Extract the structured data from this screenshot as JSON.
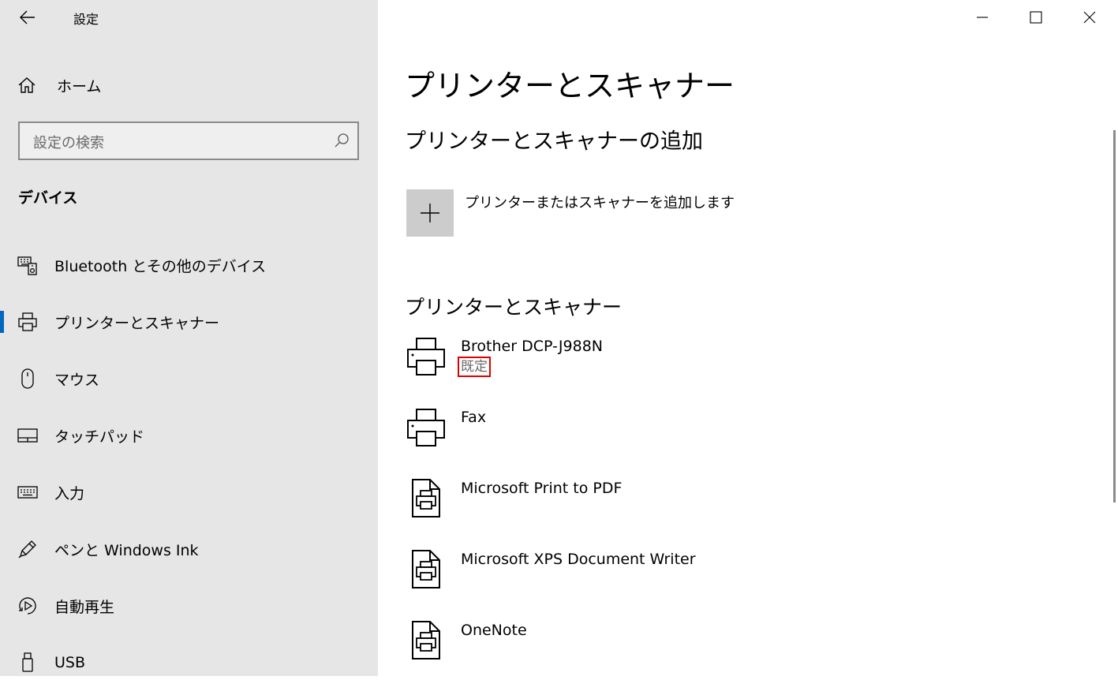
{
  "window": {
    "title": "設定"
  },
  "sidebar": {
    "home_label": "ホーム",
    "search_placeholder": "設定の検索",
    "section_title": "デバイス",
    "items": [
      {
        "label": "Bluetooth とその他のデバイス",
        "icon": "bluetooth-devices-icon",
        "active": false
      },
      {
        "label": "プリンターとスキャナー",
        "icon": "printer-icon",
        "active": true
      },
      {
        "label": "マウス",
        "icon": "mouse-icon",
        "active": false
      },
      {
        "label": "タッチパッド",
        "icon": "touchpad-icon",
        "active": false
      },
      {
        "label": "入力",
        "icon": "keyboard-icon",
        "active": false
      },
      {
        "label": "ペンと Windows Ink",
        "icon": "pen-icon",
        "active": false
      },
      {
        "label": "自動再生",
        "icon": "autoplay-icon",
        "active": false
      },
      {
        "label": "USB",
        "icon": "usb-icon",
        "active": false
      }
    ]
  },
  "main": {
    "page_title": "プリンターとスキャナー",
    "add_section_title": "プリンターとスキャナーの追加",
    "add_button_label": "プリンターまたはスキャナーを追加します",
    "list_title": "プリンターとスキャナー",
    "devices": [
      {
        "name": "Brother DCP-J988N",
        "status": "既定",
        "icon": "printer-icon"
      },
      {
        "name": "Fax",
        "status": "",
        "icon": "printer-icon"
      },
      {
        "name": "Microsoft Print to PDF",
        "status": "",
        "icon": "printer-document-icon"
      },
      {
        "name": "Microsoft XPS Document Writer",
        "status": "",
        "icon": "printer-document-icon"
      },
      {
        "name": "OneNote",
        "status": "",
        "icon": "printer-document-icon"
      }
    ]
  },
  "colors": {
    "accent": "#0067c0",
    "sidebar_bg": "#e6e6e6",
    "highlight_box": "#e00000"
  }
}
